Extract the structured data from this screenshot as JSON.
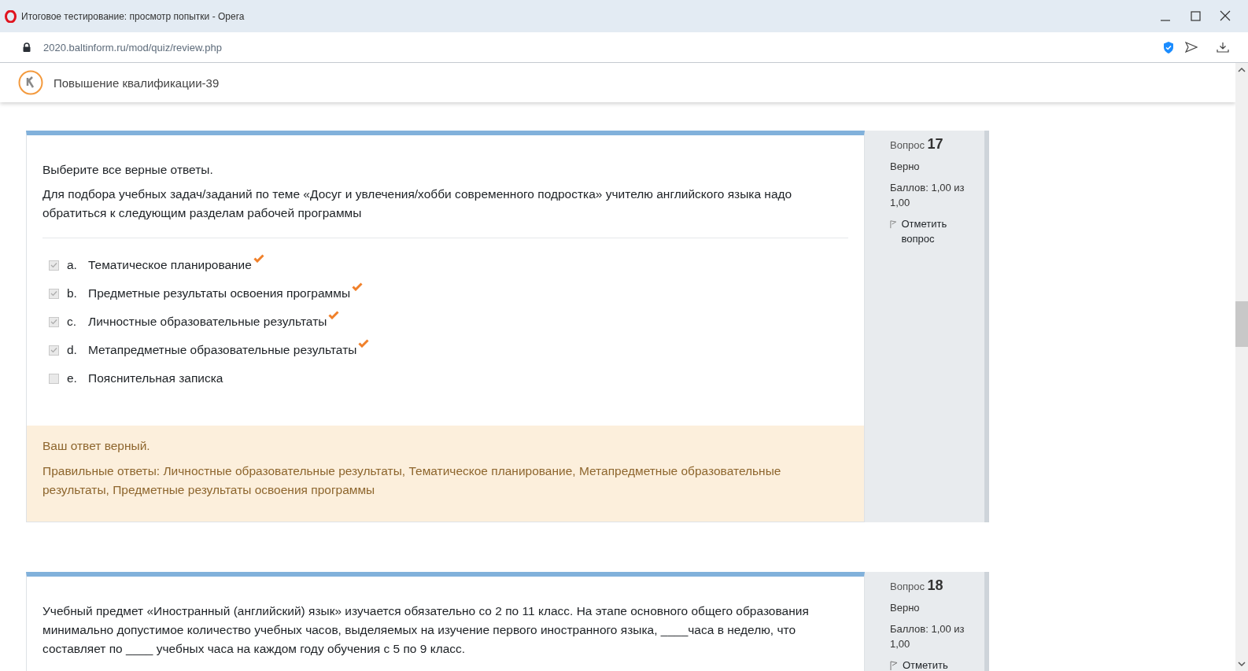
{
  "window": {
    "title": "Итоговое тестирование: просмотр попытки - Opera",
    "url": "2020.baltinform.ru/mod/quiz/review.php"
  },
  "site": {
    "name": "Повышение квалификации-39"
  },
  "questions": [
    {
      "label": "Вопрос",
      "number": "17",
      "state": "Верно",
      "grade": "Баллов: 1,00 из 1,00",
      "flag": "Отметить вопрос",
      "instruction": "Выберите все верные ответы.",
      "prompt": "Для подбора учебных задач/заданий по теме «Досуг и увлечения/хобби современного подростка» учителю английского языка надо обратиться к следующим разделам рабочей программы",
      "answers": [
        {
          "letter": "a.",
          "text": "Тематическое планирование",
          "checked": true,
          "correct": true
        },
        {
          "letter": "b.",
          "text": "Предметные результаты освоения программы",
          "checked": true,
          "correct": true
        },
        {
          "letter": "c.",
          "text": "Личностные образовательные результаты",
          "checked": true,
          "correct": true
        },
        {
          "letter": "d.",
          "text": "Метапредметные образовательные результаты",
          "checked": true,
          "correct": true
        },
        {
          "letter": "e.",
          "text": "Пояснительная записка",
          "checked": false,
          "correct": false
        }
      ],
      "feedback": {
        "result": "Ваш ответ верный.",
        "right_answer": "Правильные ответы: Личностные образовательные результаты, Тематическое планирование, Метапредметные образовательные результаты, Предметные результаты освоения программы"
      }
    },
    {
      "label": "Вопрос",
      "number": "18",
      "state": "Верно",
      "grade": "Баллов: 1,00 из 1,00",
      "flag": "Отметить",
      "prompt": "Учебный предмет «Иностранный (английский) язык» изучается обязательно со 2 по 11 класс. На этапе основного общего образования минимально допустимое количество учебных часов, выделяемых на изучение первого иностранного языка, ____часа в неделю, что составляет по ____ учебных часа на каждом году обучения с 5 по 9 класс."
    }
  ]
}
